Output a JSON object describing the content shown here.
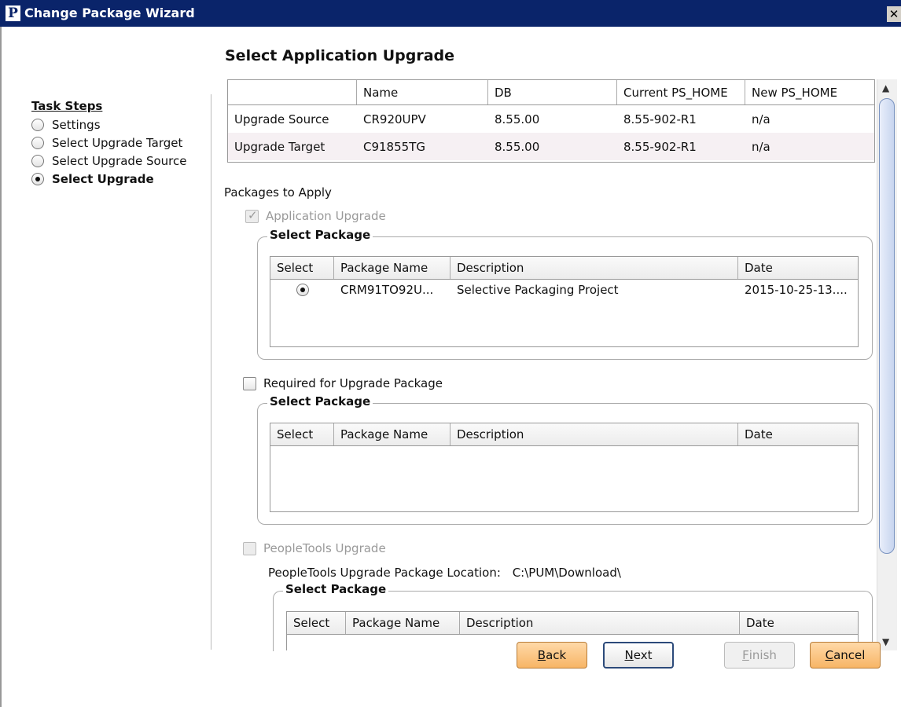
{
  "window": {
    "title": "Change Package Wizard",
    "logo": "P",
    "close_glyph": "✕"
  },
  "heading": "Select Application Upgrade",
  "task_steps": {
    "title": "Task Steps",
    "items": [
      {
        "label": "Settings",
        "selected": false
      },
      {
        "label": "Select Upgrade Target",
        "selected": false
      },
      {
        "label": "Select Upgrade Source",
        "selected": false
      },
      {
        "label": "Select Upgrade",
        "selected": true
      }
    ]
  },
  "db_table": {
    "columns": [
      "",
      "Name",
      "DB",
      "Current PS_HOME",
      "New PS_HOME"
    ],
    "rows": [
      [
        "Upgrade Source",
        "CR920UPV",
        "8.55.00",
        "8.55-902-R1",
        "n/a"
      ],
      [
        "Upgrade Target",
        "C91855TG",
        "8.55.00",
        "8.55-902-R1",
        "n/a"
      ]
    ]
  },
  "packages_to_apply": "Packages to Apply",
  "app_upgrade": {
    "label": "Application Upgrade",
    "checked": true,
    "disabled": true,
    "group_title": "Select Package",
    "columns": [
      "Select",
      "Package Name",
      "Description",
      "Date"
    ],
    "rows": [
      {
        "selected": true,
        "name": "CRM91TO92U...",
        "description": "Selective Packaging Project",
        "date": "2015-10-25-13...."
      }
    ]
  },
  "required_upgrade": {
    "label": "Required for Upgrade Package",
    "checked": false,
    "group_title": "Select Package",
    "columns": [
      "Select",
      "Package Name",
      "Description",
      "Date"
    ]
  },
  "peopletools_upgrade": {
    "label": "PeopleTools Upgrade",
    "checked": false,
    "disabled": true,
    "location_label": "PeopleTools Upgrade Package Location:",
    "location_value": "C:\\PUM\\Download\\",
    "group_title": "Select Package",
    "columns": [
      "Select",
      "Package Name",
      "Description",
      "Date"
    ]
  },
  "scroll": {
    "up": "▲",
    "down": "▼"
  },
  "buttons": {
    "back": {
      "mnemonic": "B",
      "rest": "ack"
    },
    "next": {
      "mnemonic": "N",
      "rest": "ext"
    },
    "finish": {
      "mnemonic": "F",
      "rest": "inish"
    },
    "cancel": {
      "mnemonic": "C",
      "rest": "ancel"
    }
  }
}
